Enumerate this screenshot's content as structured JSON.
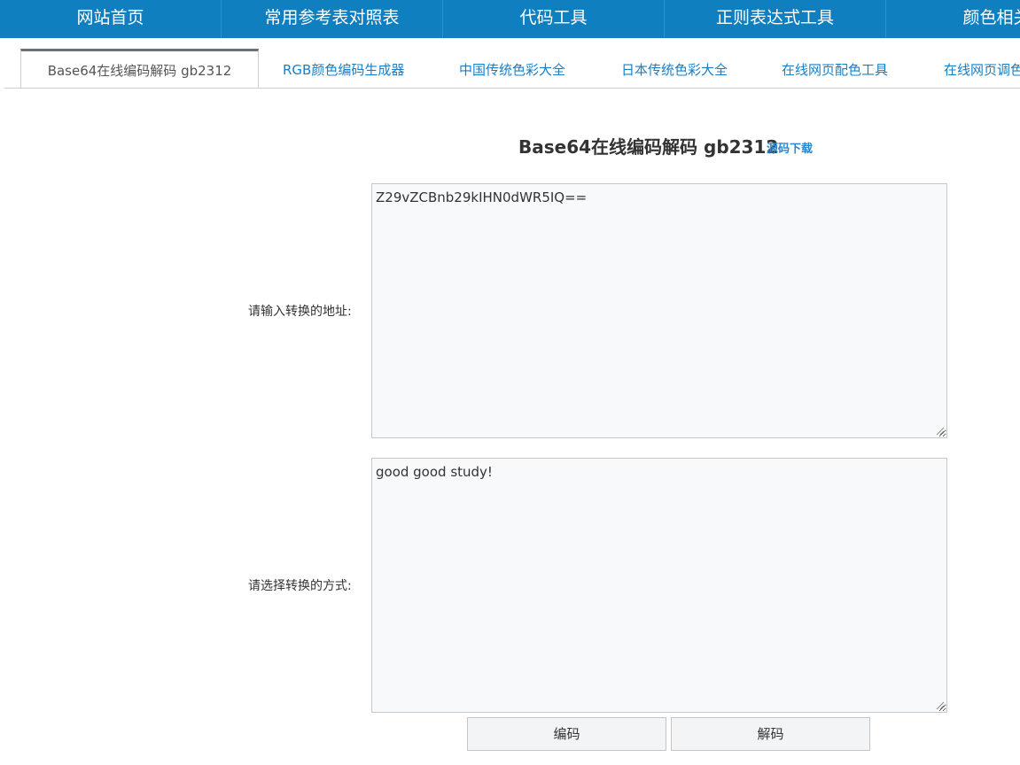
{
  "topnav": {
    "items": [
      "网站首页",
      "常用参考表对照表",
      "代码工具",
      "正则表达式工具",
      "颜色相关"
    ]
  },
  "tabs": {
    "items": [
      {
        "label": "Base64在线编码解码 gb2312",
        "active": true
      },
      {
        "label": "RGB颜色编码生成器",
        "active": false
      },
      {
        "label": "中国传统色彩大全",
        "active": false
      },
      {
        "label": "日本传统色彩大全",
        "active": false
      },
      {
        "label": "在线网页配色工具",
        "active": false
      },
      {
        "label": "在线网页调色",
        "active": false
      }
    ]
  },
  "main": {
    "title": "Base64在线编码解码 gb2312",
    "source_link": "源码下载",
    "input_label": "请输入转换的地址:",
    "input_value": "Z29vZCBnb29kIHN0dWR5IQ==",
    "output_label": "请选择转换的方式:",
    "output_value": "good good study!",
    "encode_label": "编码",
    "decode_label": "解码"
  },
  "colors": {
    "nav_bg": "#0f7fbf",
    "tab_link": "#1a7ec4",
    "link": "#2d86c8",
    "textarea_bg": "#f8f9fa"
  }
}
